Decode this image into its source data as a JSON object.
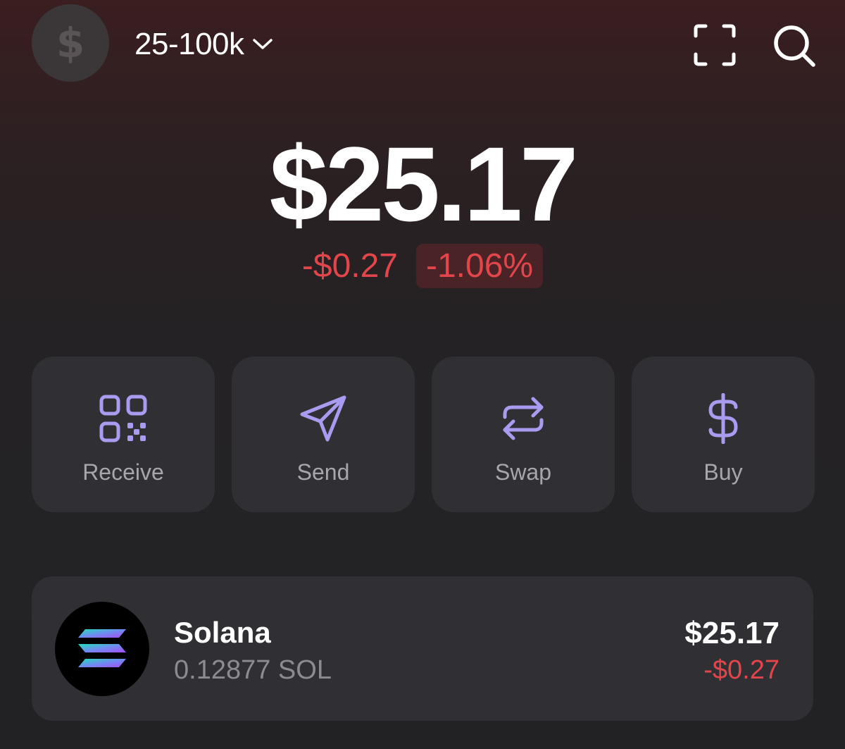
{
  "header": {
    "avatar_icon": "dollar-icon",
    "account_name": "25-100k",
    "account_dropdown_icon": "chevron-down-icon",
    "scan_icon": "scan-icon",
    "search_icon": "search-icon"
  },
  "balance": {
    "total": "$25.17",
    "change_amount": "-$0.27",
    "change_percent": "-1.06%"
  },
  "actions": [
    {
      "label": "Receive",
      "icon": "qr-code-icon"
    },
    {
      "label": "Send",
      "icon": "paper-plane-icon"
    },
    {
      "label": "Swap",
      "icon": "swap-arrows-icon"
    },
    {
      "label": "Buy",
      "icon": "dollar-icon"
    }
  ],
  "tokens": [
    {
      "name": "Solana",
      "amount": "0.12877 SOL",
      "value": "$25.17",
      "change": "-$0.27",
      "icon": "solana-logo-icon"
    }
  ],
  "colors": {
    "accent": "#a99cf0",
    "negative": "#e2464a",
    "card": "#2f2f34"
  }
}
